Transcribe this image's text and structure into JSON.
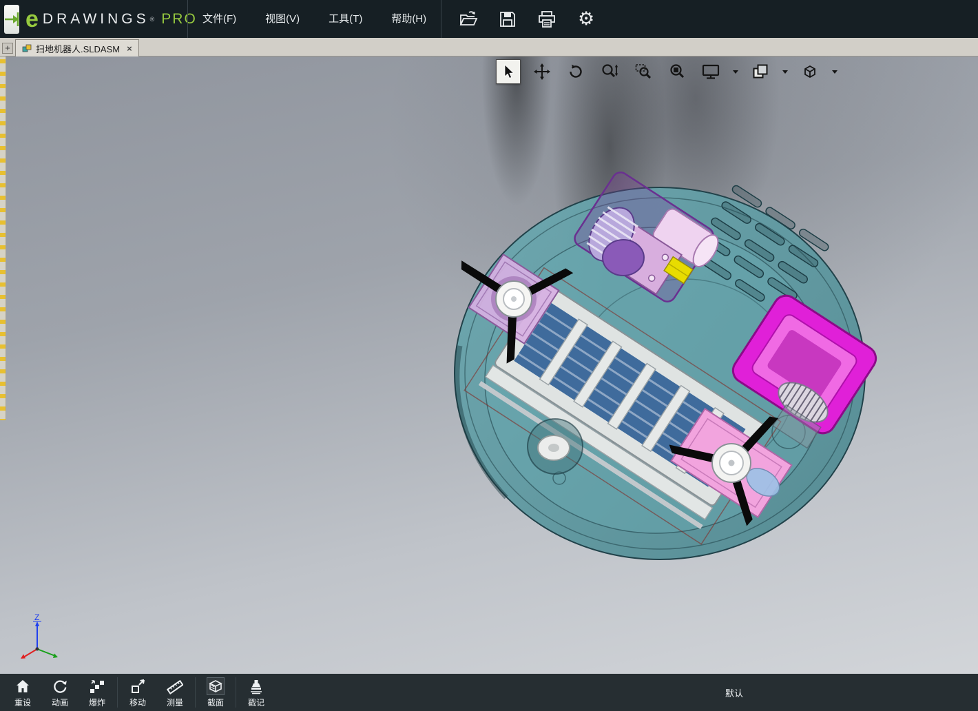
{
  "app": {
    "title_e": "e",
    "title_drawings": "DRAWINGS",
    "title_reg": "®",
    "title_pro": "PRO"
  },
  "menu": {
    "items": [
      {
        "label": "文件(F)"
      },
      {
        "label": "视图(V)"
      },
      {
        "label": "工具(T)"
      },
      {
        "label": "帮助(H)"
      }
    ]
  },
  "toolbar": {
    "icons": [
      "open-icon",
      "save-icon",
      "print-icon",
      "settings-gear-icon"
    ]
  },
  "tabbar": {
    "new_tab": "+",
    "tabs": [
      {
        "label": "扫地机器人.SLDASM",
        "close": "×",
        "active": true
      }
    ]
  },
  "viewport": {
    "tools": [
      "select-tool",
      "pan-tool",
      "rotate-tool",
      "zoom-tool",
      "zoom-window-tool",
      "zoom-fit-tool",
      "full-screen-tool",
      "components-tool",
      "view-orientation-tool"
    ],
    "active_tool": "select-tool",
    "triad": {
      "z_label": "Z"
    },
    "model": "robot-vacuum-assembly-bottom-view"
  },
  "bottom_toolbar": {
    "items": [
      {
        "label": "重设"
      },
      {
        "label": "动画"
      },
      {
        "label": "爆炸"
      },
      {
        "label": "移动"
      },
      {
        "label": "测量"
      },
      {
        "label": "截面"
      },
      {
        "label": "戳记"
      }
    ],
    "configuration": "默认"
  },
  "colors": {
    "accent_green": "#97ca3f",
    "header_bg": "#161f24",
    "tabbar_bg": "#d2cfc8",
    "bottombar_bg": "#262e32",
    "model_teal": "#579aa4",
    "model_magenta": "#e020d8",
    "model_pink": "#f0a0dc",
    "model_purple": "#8a5ab8",
    "highlight_yellow": "#e8d800"
  }
}
